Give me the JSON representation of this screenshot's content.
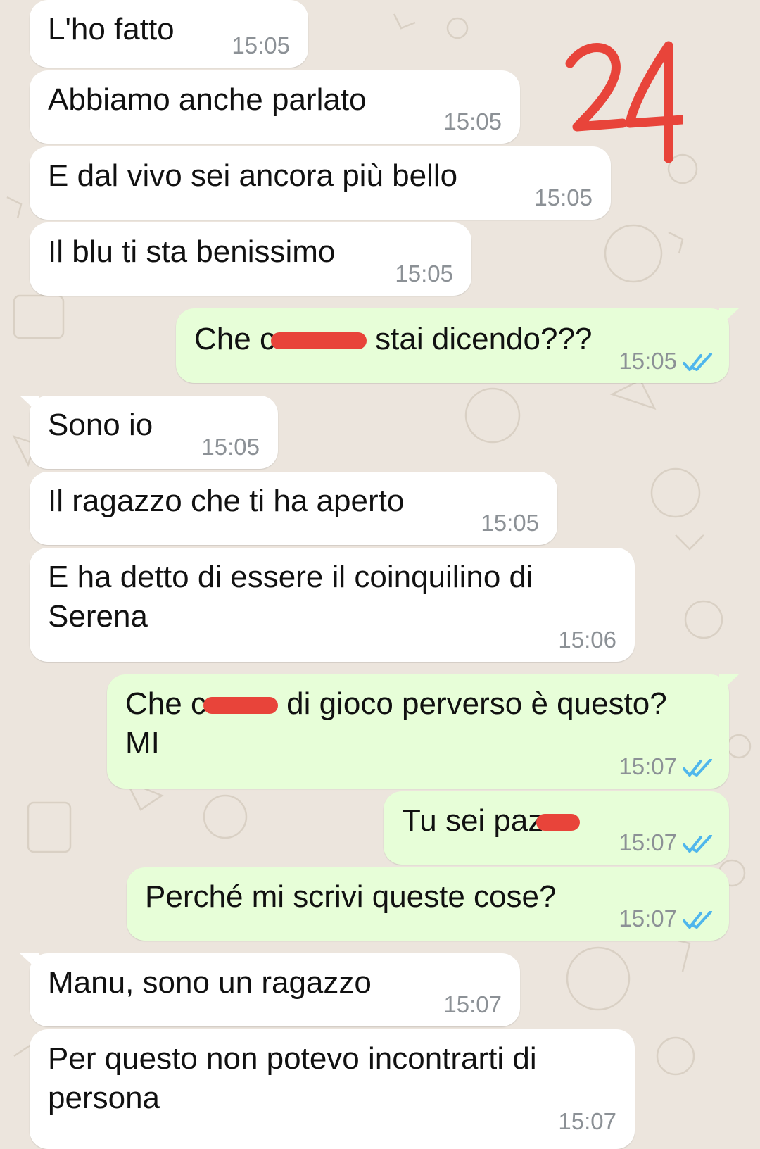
{
  "annotation": {
    "label": "24",
    "color": "#e8443a"
  },
  "colors": {
    "incoming": "#ffffff",
    "outgoing": "#e7fed8",
    "tick": "#4fb6ec",
    "wallpaper": "#ece5dd",
    "redaction": "#e8443a"
  },
  "messages": [
    {
      "dir": "in",
      "text": "L'ho fatto",
      "time": "15:05"
    },
    {
      "dir": "in",
      "text": "Abbiamo anche parlato",
      "time": "15:05"
    },
    {
      "dir": "in",
      "text": "E dal vivo sei ancora più bello",
      "time": "15:05"
    },
    {
      "dir": "in",
      "text": "Il blu ti sta benissimo",
      "time": "15:05"
    },
    {
      "dir": "out",
      "text_before": "Che c",
      "text_after": " stai dicendo???",
      "time": "15:05",
      "status": "read"
    },
    {
      "dir": "in",
      "text": "Sono io",
      "time": "15:05"
    },
    {
      "dir": "in",
      "text": "Il ragazzo che ti ha aperto",
      "time": "15:05"
    },
    {
      "dir": "in",
      "text": "E ha detto di essere il coinquilino di Serena",
      "time": "15:06"
    },
    {
      "dir": "out",
      "text_before": "Che c",
      "text_after": " di gioco perverso è questo? MI",
      "time": "15:07",
      "status": "read"
    },
    {
      "dir": "out",
      "text_before": "Tu sei paz",
      "text_after": "",
      "time": "15:07",
      "status": "read"
    },
    {
      "dir": "out",
      "text": "Perché mi scrivi queste cose?",
      "time": "15:07",
      "status": "read"
    },
    {
      "dir": "in",
      "text": "Manu, sono un ragazzo",
      "time": "15:07"
    },
    {
      "dir": "in",
      "text": "Per questo non potevo incontrarti di persona",
      "time": "15:07"
    }
  ]
}
